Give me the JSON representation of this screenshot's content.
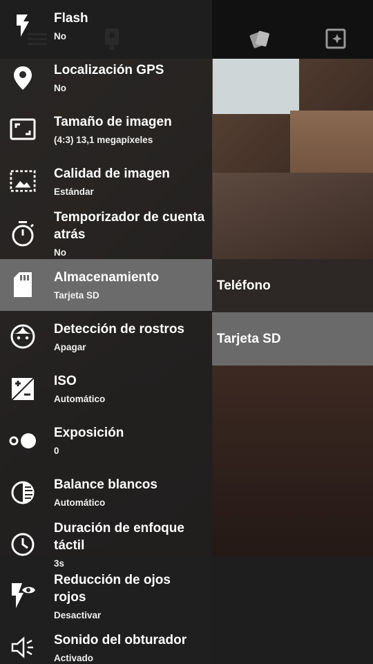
{
  "settings": [
    {
      "title": "Flash",
      "value": "No",
      "icon": "flash-icon"
    },
    {
      "title": "Localización GPS",
      "value": "No",
      "icon": "location-pin-icon"
    },
    {
      "title": "Tamaño de imagen",
      "value": "(4:3) 13,1 megapíxeles",
      "icon": "aspect-ratio-icon"
    },
    {
      "title": "Calidad de imagen",
      "value": "Estándar",
      "icon": "image-quality-icon"
    },
    {
      "title": "Temporizador de cuenta atrás",
      "value": "No",
      "icon": "timer-icon"
    },
    {
      "title": "Almacenamiento",
      "value": "Tarjeta SD",
      "icon": "sd-card-icon"
    },
    {
      "title": "Detección de rostros",
      "value": "Apagar",
      "icon": "face-icon"
    },
    {
      "title": "ISO",
      "value": "Automático",
      "icon": "iso-icon"
    },
    {
      "title": "Exposición",
      "value": "0",
      "icon": "exposure-icon"
    },
    {
      "title": "Balance blancos",
      "value": "Automático",
      "icon": "white-balance-icon"
    },
    {
      "title": "Duración de enfoque táctil",
      "value": "3s",
      "icon": "clock-icon"
    },
    {
      "title": "Reducción de ojos rojos",
      "value": "Desactivar",
      "icon": "red-eye-icon"
    },
    {
      "title": "Sonido del obturador",
      "value": "Activado",
      "icon": "speaker-icon"
    }
  ],
  "storage_options": [
    "Teléfono",
    "Tarjeta SD"
  ],
  "selected_storage": "Tarjeta SD",
  "colors": {
    "selected_row": "#6b6b6b",
    "drawer": "#202020"
  }
}
